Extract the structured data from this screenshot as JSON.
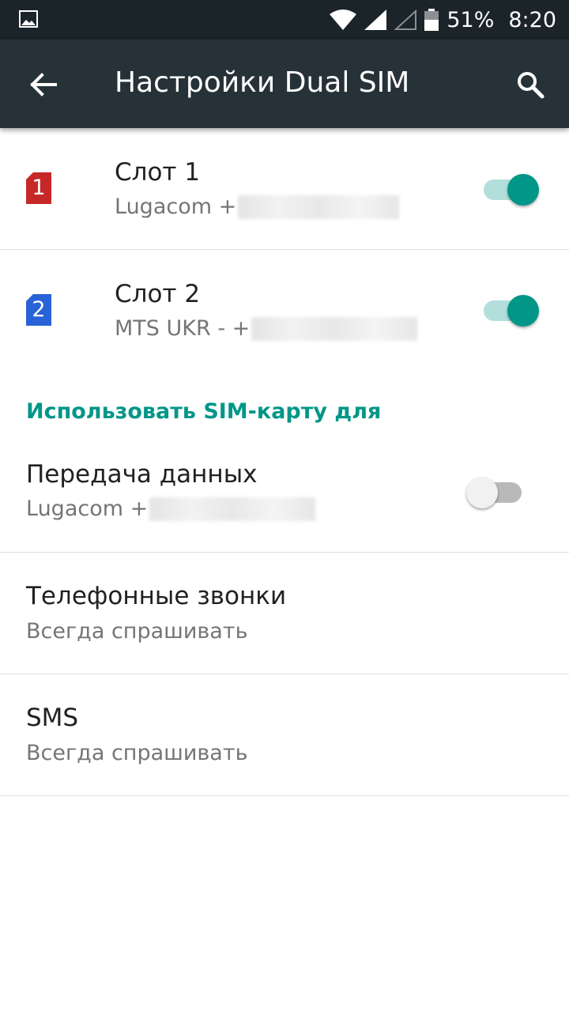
{
  "status_bar": {
    "battery_percent": "51%",
    "time": "8:20"
  },
  "app_bar": {
    "title": "Настройки Dual SIM"
  },
  "sim_slots": [
    {
      "number": "1",
      "title": "Слот 1",
      "subtitle": "Lugacom +",
      "enabled": true,
      "icon_color": "#c62828"
    },
    {
      "number": "2",
      "title": "Слот 2",
      "subtitle": "MTS UKR - +",
      "enabled": true,
      "icon_color": "#2962d6"
    }
  ],
  "section": {
    "header": "Использовать SIM-карту для"
  },
  "preferences": [
    {
      "title": "Передача данных",
      "subtitle": "Lugacom +",
      "enabled": false
    },
    {
      "title": "Телефонные звонки",
      "subtitle": "Всегда спрашивать"
    },
    {
      "title": "SMS",
      "subtitle": "Всегда спрашивать"
    }
  ],
  "colors": {
    "accent": "#009688",
    "app_bar": "#263238",
    "status_bar": "#1b2429"
  },
  "icons": [
    "image-notification-icon",
    "wifi-icon",
    "signal-icon",
    "signal-empty-icon",
    "battery-icon",
    "back-arrow-icon",
    "search-icon"
  ]
}
